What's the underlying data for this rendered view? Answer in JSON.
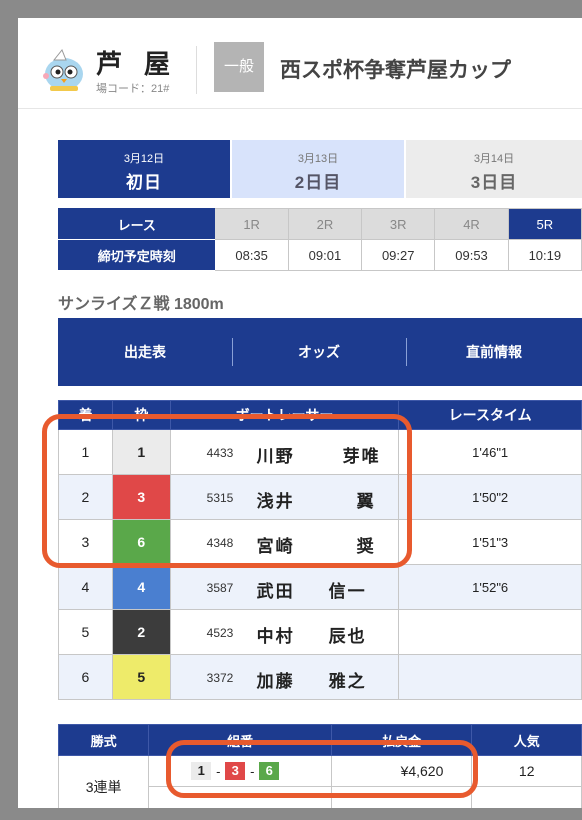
{
  "venue": {
    "name": "芦屋",
    "code_label": "場コード：21#"
  },
  "race_meta": {
    "grade": "一般",
    "title": "西スポ杯争奪芦屋カップ"
  },
  "day_tabs": [
    {
      "date": "3月12日",
      "label": "初日"
    },
    {
      "date": "3月13日",
      "label": "2日目"
    },
    {
      "date": "3月14日",
      "label": "3日目"
    }
  ],
  "race_table": {
    "race_header": "レース",
    "time_header": "締切予定時刻",
    "races": [
      {
        "label": "1R",
        "time": "08:35"
      },
      {
        "label": "2R",
        "time": "09:01"
      },
      {
        "label": "3R",
        "time": "09:27"
      },
      {
        "label": "4R",
        "time": "09:53"
      },
      {
        "label": "5R",
        "time": "10:19"
      }
    ]
  },
  "race_name": "サンライズＺ戦 1800m",
  "info_tabs": [
    "出走表",
    "オッズ",
    "直前情報"
  ],
  "results": {
    "headers": {
      "rank": "着",
      "boat": "枠",
      "racer": "ボートレーサー",
      "time": "レースタイム"
    },
    "rows": [
      {
        "rank": "1",
        "boat": "1",
        "reg": "4433",
        "family": "川野",
        "given": "芽唯",
        "time": "1'46\"1"
      },
      {
        "rank": "2",
        "boat": "3",
        "reg": "5315",
        "family": "浅井",
        "given": "翼",
        "time": "1'50\"2"
      },
      {
        "rank": "3",
        "boat": "6",
        "reg": "4348",
        "family": "宮崎",
        "given": "奨",
        "time": "1'51\"3"
      },
      {
        "rank": "4",
        "boat": "4",
        "reg": "3587",
        "family": "武田",
        "given": "信一",
        "time": "1'52\"6"
      },
      {
        "rank": "5",
        "boat": "2",
        "reg": "4523",
        "family": "中村",
        "given": "辰也",
        "time": ""
      },
      {
        "rank": "6",
        "boat": "5",
        "reg": "3372",
        "family": "加藤",
        "given": "雅之",
        "time": ""
      }
    ]
  },
  "payout": {
    "headers": {
      "type": "勝式",
      "combo": "組番",
      "amount": "払戻金",
      "popularity": "人気"
    },
    "bet_type": "3連単",
    "combo": [
      "1",
      "3",
      "6"
    ],
    "dash": "-",
    "amount": "¥4,620",
    "popularity": "12"
  },
  "colors": {
    "accent": "#1d3b8f",
    "highlight": "#e85a2e"
  }
}
